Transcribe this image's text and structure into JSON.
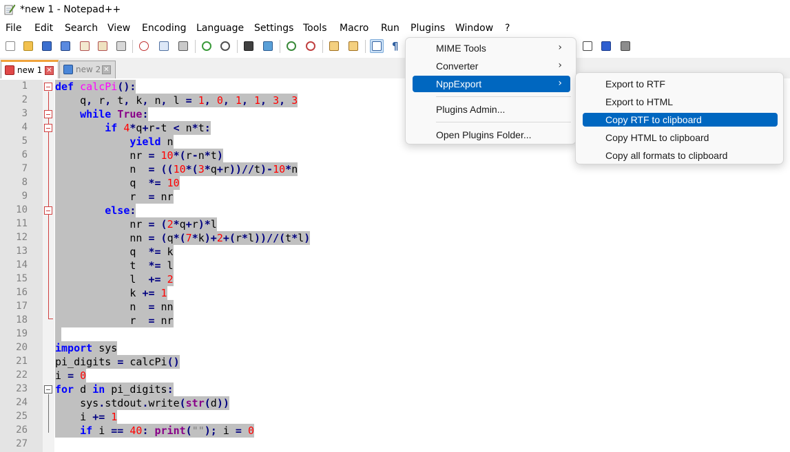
{
  "window": {
    "title": "*new 1 - Notepad++"
  },
  "menu": [
    "File",
    "Edit",
    "Search",
    "View",
    "Encoding",
    "Language",
    "Settings",
    "Tools",
    "Macro",
    "Run",
    "Plugins",
    "Window",
    "?"
  ],
  "tabs": [
    {
      "label": "new 1",
      "state": "active",
      "close": "✕"
    },
    {
      "label": "new 2",
      "state": "inactive",
      "close": "✕"
    }
  ],
  "line_numbers": [
    "1",
    "2",
    "3",
    "4",
    "5",
    "6",
    "7",
    "8",
    "9",
    "10",
    "11",
    "12",
    "13",
    "14",
    "15",
    "16",
    "17",
    "18",
    "19",
    "20",
    "21",
    "22",
    "23",
    "24",
    "25",
    "26",
    "27"
  ],
  "plugins_menu": {
    "items": [
      {
        "label": "MIME Tools",
        "arrow": "›"
      },
      {
        "label": "Converter",
        "arrow": "›"
      },
      {
        "label": "NppExport",
        "arrow": "›"
      },
      {
        "label": "Plugins Admin..."
      },
      {
        "label": "Open Plugins Folder..."
      }
    ]
  },
  "nppexport_submenu": {
    "items": [
      {
        "label": "Export to RTF"
      },
      {
        "label": "Export to HTML"
      },
      {
        "label": "Copy RTF to clipboard"
      },
      {
        "label": "Copy HTML to clipboard"
      },
      {
        "label": "Copy all formats to clipboard"
      }
    ]
  },
  "colors": {
    "accent": "#0067c0",
    "selection": "#c0c0c0",
    "keyword": "#0000ff",
    "number": "#ff0000",
    "function": "#ff00ff",
    "tab_accent": "#f0a23a"
  },
  "icons": [
    "notepad-app-icon",
    "new-file-icon",
    "open-file-icon",
    "save-icon",
    "save-all-icon",
    "close-icon",
    "close-all-icon",
    "print-icon",
    "cut-icon",
    "copy-icon",
    "paste-icon",
    "undo-icon",
    "redo-icon",
    "find-icon",
    "replace-icon",
    "zoom-in-icon",
    "zoom-out-icon",
    "sync-vertical-icon",
    "sync-horizontal-icon",
    "word-wrap-icon",
    "show-all-chars-icon",
    "play-macro-icon",
    "run-macro-multiple-icon",
    "save-macro-icon"
  ]
}
